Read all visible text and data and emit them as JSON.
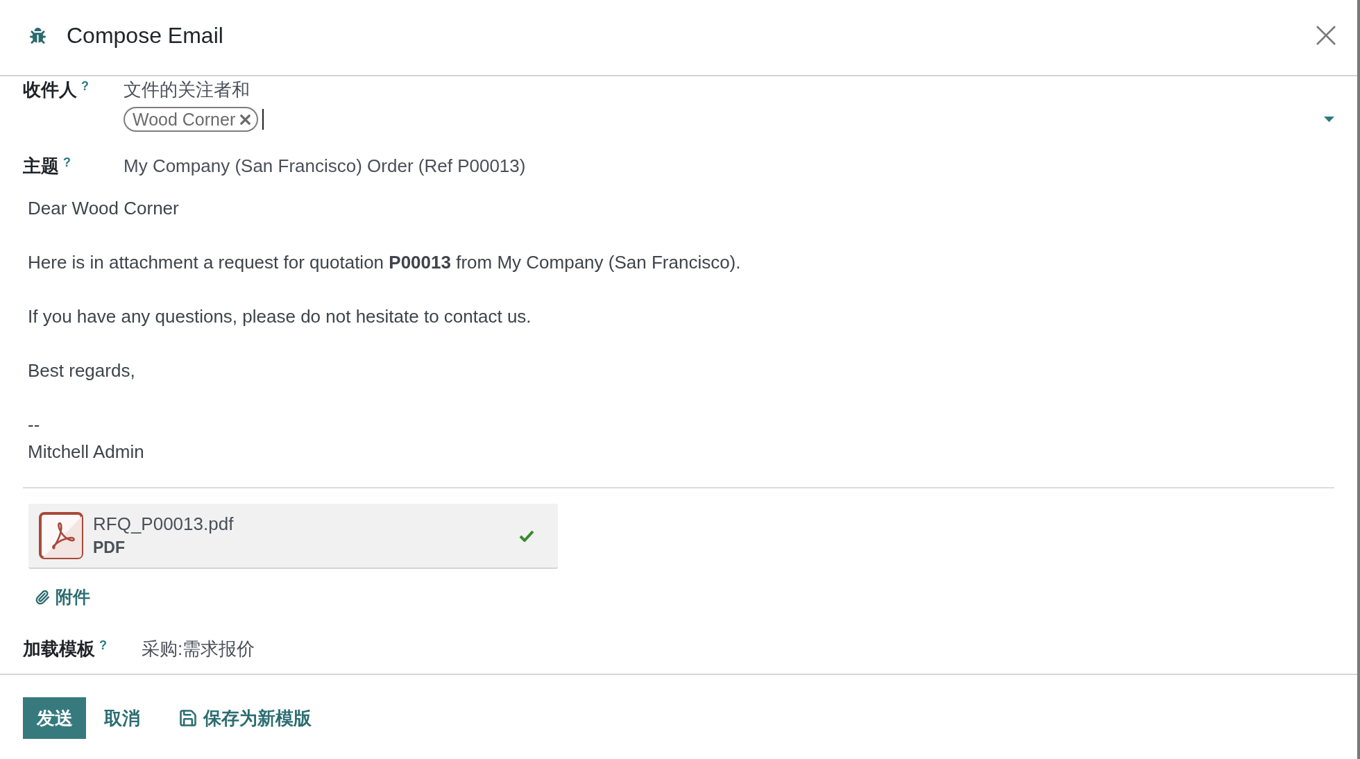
{
  "dialog": {
    "title": "Compose Email"
  },
  "fields": [
    {
      "kind": "recipients",
      "label": "收件人",
      "help": "?",
      "value": "文件的关注者和",
      "tags": [
        {
          "label": "Wood Corner"
        }
      ]
    },
    {
      "kind": "text",
      "label": "主题",
      "help": "?",
      "value": "My Company (San Francisco) Order (Ref P00013)"
    }
  ],
  "body": {
    "paragraphs": [
      [
        "Dear Wood Corner"
      ],
      [
        "Here is in attachment a request for quotation **P00013** from My Company (San Francisco)."
      ],
      [
        "If you have any questions, please do not hesitate to contact us."
      ],
      [
        "Best regards,"
      ],
      [
        "--",
        "Mitchell Admin"
      ]
    ]
  },
  "attachments": [
    {
      "name": "RFQ_P00013.pdf",
      "type": "PDF",
      "uploaded": true
    }
  ],
  "attach_button": {
    "label": "附件"
  },
  "template": {
    "label": "加载模板",
    "help": "?",
    "value": "采购:需求报价"
  },
  "footer": {
    "buttons": [
      {
        "kind": "primary",
        "label": "发送"
      },
      {
        "kind": "link",
        "label": "取消"
      },
      {
        "kind": "save",
        "label": "保存为新模版"
      }
    ]
  }
}
